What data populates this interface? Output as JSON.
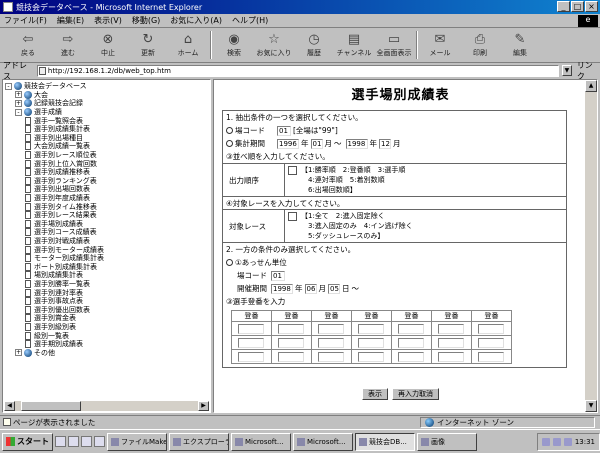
{
  "window": {
    "title": "競技会データベース - Microsoft Internet Explorer"
  },
  "menu": [
    "ファイル(F)",
    "編集(E)",
    "表示(V)",
    "移動(G)",
    "お気に入り(A)",
    "ヘルプ(H)"
  ],
  "toolbar": [
    {
      "label": "戻る",
      "icon": "back-icon"
    },
    {
      "label": "進む",
      "icon": "forward-icon"
    },
    {
      "label": "中止",
      "icon": "stop-icon"
    },
    {
      "label": "更新",
      "icon": "refresh-icon"
    },
    {
      "label": "ホーム",
      "icon": "home-icon"
    },
    {
      "label": "検索",
      "icon": "search-icon"
    },
    {
      "label": "お気に入り",
      "icon": "favorites-icon"
    },
    {
      "label": "履歴",
      "icon": "history-icon"
    },
    {
      "label": "チャンネル",
      "icon": "channels-icon"
    },
    {
      "label": "全画面表示",
      "icon": "fullscreen-icon"
    },
    {
      "label": "メール",
      "icon": "mail-icon"
    },
    {
      "label": "印刷",
      "icon": "print-icon"
    },
    {
      "label": "編集",
      "icon": "edit-icon"
    }
  ],
  "address": {
    "label": "アドレス",
    "value": "http://192.168.1.2/db/web_top.htm",
    "go": "リンク"
  },
  "tree": [
    {
      "level": 0,
      "kind": "globe",
      "exp": "-",
      "label": "競技会データベース"
    },
    {
      "level": 1,
      "kind": "globe",
      "exp": "+",
      "label": "大会"
    },
    {
      "level": 1,
      "kind": "globe",
      "exp": "+",
      "label": "記録競技会記録"
    },
    {
      "level": 1,
      "kind": "globe",
      "exp": "-",
      "label": "選手成績"
    },
    {
      "level": 2,
      "kind": "doc",
      "label": "選手一覧照会表"
    },
    {
      "level": 2,
      "kind": "doc",
      "label": "選手別成績集計表"
    },
    {
      "level": 2,
      "kind": "doc",
      "label": "選手別出場種目"
    },
    {
      "level": 2,
      "kind": "doc",
      "label": "大会別成績一覧表"
    },
    {
      "level": 2,
      "kind": "doc",
      "label": "選手別レース順位表"
    },
    {
      "level": 2,
      "kind": "doc",
      "label": "選手別上位入賞回数"
    },
    {
      "level": 2,
      "kind": "doc",
      "label": "選手別成績推移表"
    },
    {
      "level": 2,
      "kind": "doc",
      "label": "選手別ランキング表"
    },
    {
      "level": 2,
      "kind": "doc",
      "label": "選手別出場回数表"
    },
    {
      "level": 2,
      "kind": "doc",
      "label": "選手別年度成績表"
    },
    {
      "level": 2,
      "kind": "doc",
      "label": "選手別タイム推移表"
    },
    {
      "level": 2,
      "kind": "doc",
      "label": "選手別レース結果表"
    },
    {
      "level": 2,
      "kind": "doc",
      "label": "選手場別成績表"
    },
    {
      "level": 2,
      "kind": "doc",
      "label": "選手別コース成績表"
    },
    {
      "level": 2,
      "kind": "doc",
      "label": "選手別対戦成績表"
    },
    {
      "level": 2,
      "kind": "doc",
      "label": "選手別モーター成績表"
    },
    {
      "level": 2,
      "kind": "doc",
      "label": "モーター別成績集計表"
    },
    {
      "level": 2,
      "kind": "doc",
      "label": "ボート別成績集計表"
    },
    {
      "level": 2,
      "kind": "doc",
      "label": "場別成績集計表"
    },
    {
      "level": 2,
      "kind": "doc",
      "label": "選手別勝率一覧表"
    },
    {
      "level": 2,
      "kind": "doc",
      "label": "選手別連対率表"
    },
    {
      "level": 2,
      "kind": "doc",
      "label": "選手別事故点表"
    },
    {
      "level": 2,
      "kind": "doc",
      "label": "選手別優出回数表"
    },
    {
      "level": 2,
      "kind": "doc",
      "label": "選手別賞金表"
    },
    {
      "level": 2,
      "kind": "doc",
      "label": "選手別級別表"
    },
    {
      "level": 2,
      "kind": "doc",
      "label": "級別一覧表"
    },
    {
      "level": 2,
      "kind": "doc",
      "label": "選手期別成績表"
    },
    {
      "level": 1,
      "kind": "globe",
      "exp": "+",
      "label": "その他"
    }
  ],
  "page": {
    "title": "選手場別成績表",
    "sec1_header": "1. 抽出条件の一つを選択してください。",
    "row_code_label": "場コード",
    "row_code_value": "01",
    "row_code_suffix": "[全場は\"99\"]",
    "row_period_label": "集計期間",
    "period_from_year": "1996",
    "period_from_month": "01",
    "period_to_year": "1998",
    "period_to_month": "12",
    "unit_year": "年",
    "unit_month": "月",
    "unit_range": "〜",
    "sort_header": "③並べ順を入力してください。",
    "sort_caption": "出力順序",
    "sort_lines": [
      "【1:勝率順　2:登番順　3:選手順",
      "　4:連対率順　5:着別数順",
      "　6:出場回数順】"
    ],
    "race_header": "④対象レースを入力してください。",
    "race_caption": "対象レース",
    "race_lines": [
      "【1:全て　2:進入固定除く",
      "　3:進入固定のみ　4:イン逃げ除く",
      "　5:ダッシュレースのみ】"
    ],
    "sec2_header": "2. 一方の条件のみ選択してください。",
    "sec2_sub": "①あっせん単位",
    "sec2_code_label": "場コード",
    "sec2_code_value": "01",
    "sec2_period_label": "開催期間",
    "sec2_period_year": "1998",
    "sec2_period_month": "06",
    "sec2_period_day": "05",
    "unit_day": "日",
    "sec3_header": "③選手登番を入力",
    "grid_headers": [
      "登番",
      "登番",
      "登番",
      "登番",
      "登番",
      "登番",
      "登番"
    ],
    "buttons": {
      "submit": "表示",
      "reset": "再入力取消"
    }
  },
  "status": {
    "text": "ページが表示されました",
    "zone": "インターネット ゾーン"
  },
  "taskbar": {
    "start": "スタート",
    "tasks": [
      {
        "label": "ファイルMaker",
        "active": false
      },
      {
        "label": "エクスプローラ",
        "active": false
      },
      {
        "label": "Microsoft...",
        "active": false
      },
      {
        "label": "Microsoft...",
        "active": false
      },
      {
        "label": "競技会DB...",
        "active": true
      },
      {
        "label": "画像",
        "active": false
      }
    ],
    "clock": "13:31"
  }
}
